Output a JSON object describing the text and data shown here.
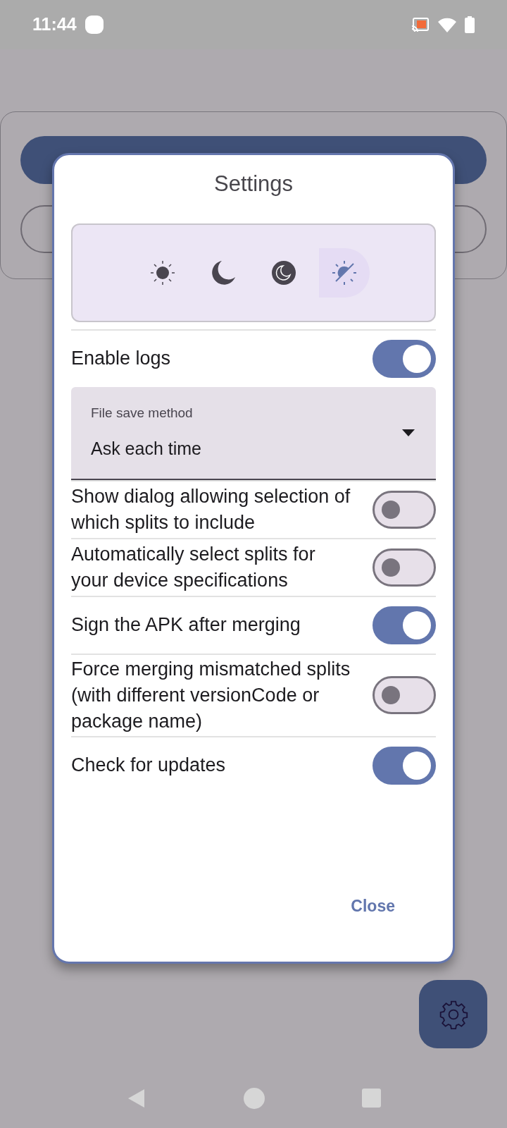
{
  "status_bar": {
    "time": "11:44"
  },
  "dialog": {
    "title": "Settings",
    "theme_options": [
      {
        "kind": "light",
        "selected": false
      },
      {
        "kind": "dark",
        "selected": false
      },
      {
        "kind": "black",
        "selected": false
      },
      {
        "kind": "system",
        "selected": true
      }
    ],
    "settings": [
      {
        "kind": "switch",
        "label": "Enable logs",
        "on": true
      },
      {
        "kind": "dropdown",
        "label": "File save method",
        "value": "Ask each time"
      },
      {
        "kind": "switch",
        "label": "Show dialog allowing selection of which splits to include",
        "on": false
      },
      {
        "kind": "switch",
        "label": "Automatically select splits for your device specifications",
        "on": false
      },
      {
        "kind": "switch",
        "label": "Sign the APK after merging",
        "on": true
      },
      {
        "kind": "switch",
        "label": "Force merging mismatched splits (with different versionCode or package name)",
        "on": false
      },
      {
        "kind": "switch",
        "label": "Check for updates",
        "on": true
      }
    ],
    "close_button": "Close"
  }
}
